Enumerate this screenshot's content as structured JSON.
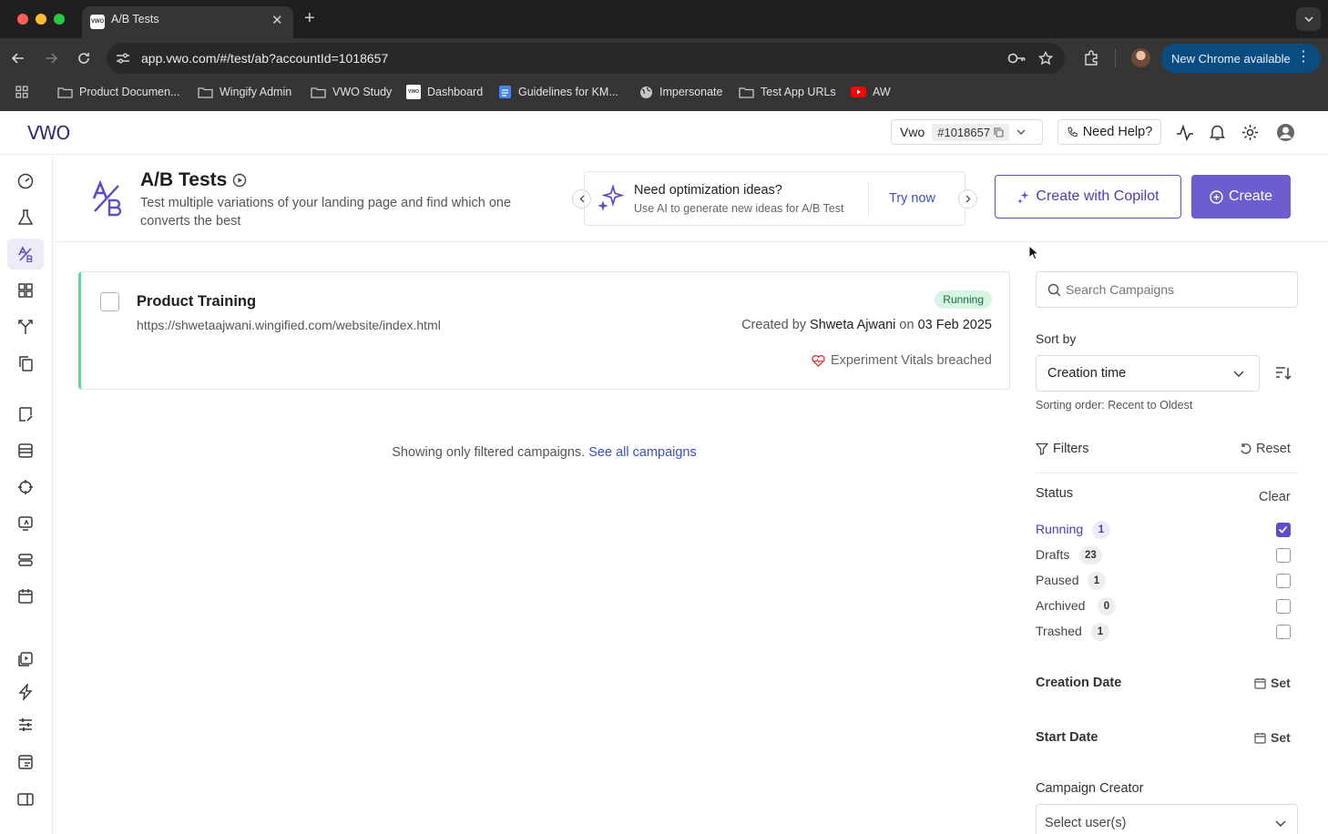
{
  "browser": {
    "tab_title": "A/B Tests",
    "tab_favicon_text": "VWO",
    "url": "app.vwo.com/#/test/ab?accountId=1018657",
    "update_button": "New Chrome available",
    "bookmarks": [
      {
        "label": "Product Documen...",
        "icon": "folder-icon"
      },
      {
        "label": "Wingify Admin",
        "icon": "folder-icon"
      },
      {
        "label": "VWO Study",
        "icon": "folder-icon"
      },
      {
        "label": "Dashboard",
        "icon": "vwo-favicon"
      },
      {
        "label": "Guidelines for KM...",
        "icon": "docs-icon"
      },
      {
        "label": "Impersonate",
        "icon": "globe-icon"
      },
      {
        "label": "Test App URLs",
        "icon": "folder-icon"
      },
      {
        "label": "AW",
        "icon": "youtube-icon"
      }
    ]
  },
  "header": {
    "logo": "VWO",
    "account_name": "Vwo",
    "account_id": "#1018657",
    "help_label": "Need Help?"
  },
  "page": {
    "title": "A/B Tests",
    "description": "Test multiple variations of your landing page and find which one converts the best",
    "promo": {
      "title": "Need optimization ideas?",
      "subtitle": "Use AI to generate new ideas for A/B Test",
      "cta": "Try now"
    },
    "copilot_button": "Create with Copilot",
    "create_button": "Create"
  },
  "campaigns": [
    {
      "name": "Product Training",
      "url": "https://shwetaajwani.wingified.com/website/index.html",
      "status": "Running",
      "created_prefix": "Created by",
      "creator": "Shweta Ajwani",
      "on_word": "on",
      "date": "03 Feb 2025",
      "vitals": "Experiment Vitals breached"
    }
  ],
  "filter_notice": {
    "text": "Showing only filtered campaigns.",
    "link": "See all campaigns"
  },
  "right_panel": {
    "search_placeholder": "Search Campaigns",
    "sort_by_label": "Sort by",
    "sort_value": "Creation time",
    "sort_order": "Sorting order: Recent to Oldest",
    "filters_label": "Filters",
    "reset_label": "Reset",
    "status_label": "Status",
    "clear_label": "Clear",
    "statuses": [
      {
        "label": "Running",
        "count": "1",
        "checked": true
      },
      {
        "label": "Drafts",
        "count": "23",
        "checked": false
      },
      {
        "label": "Paused",
        "count": "1",
        "checked": false
      },
      {
        "label": "Archived",
        "count": "0",
        "checked": false
      },
      {
        "label": "Trashed",
        "count": "1",
        "checked": false
      }
    ],
    "creation_date_label": "Creation Date",
    "start_date_label": "Start Date",
    "set_label": "Set",
    "creator_label": "Campaign Creator",
    "creator_placeholder": "Select user(s)"
  },
  "colors": {
    "accent": "#5c4ec6",
    "running_green": "#5fd69a",
    "running_badge_bg": "#d6f5e3",
    "link_blue": "#3a4fc8"
  }
}
